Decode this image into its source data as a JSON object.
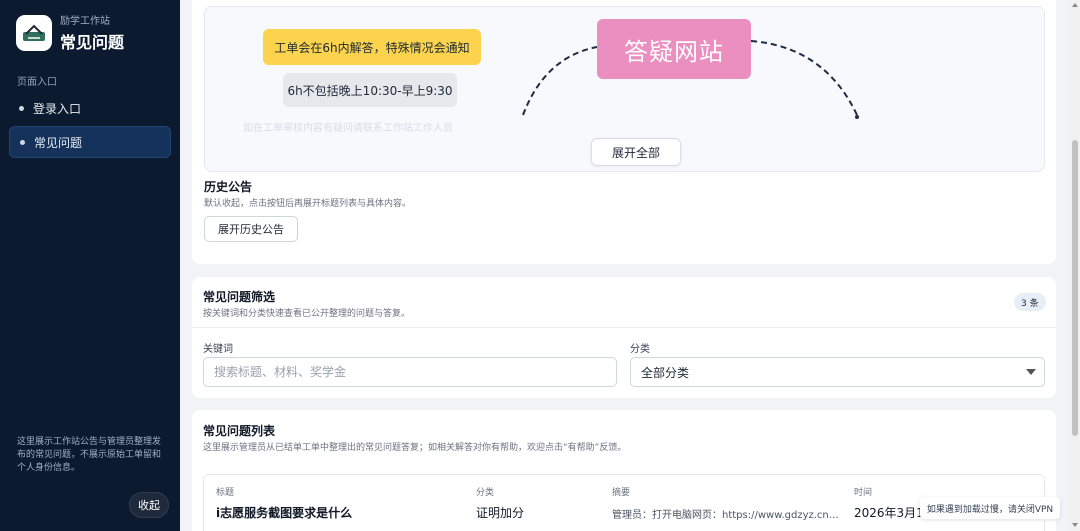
{
  "sidebar": {
    "brand_sub": "励学工作站",
    "brand_title": "常见问题",
    "section_label": "页面入口",
    "items": [
      {
        "label": "登录入口",
        "active": false
      },
      {
        "label": "常见问题",
        "active": true
      }
    ],
    "note": "这里展示工作站公告与管理员整理发布的常见问题，不展示原始工单留和个人身份信息。",
    "collapse_label": "收起"
  },
  "announcement": {
    "yellow_tag": "工单会在6h内解答，特殊情况会通知",
    "gray_tag": "6h不包括晚上10:30-早上9:30",
    "pink_box": "答疑网站",
    "faded_text": "如在工单审核内容有疑问请联系工作站工作人员",
    "expand_all": "展开全部"
  },
  "history": {
    "title": "历史公告",
    "subtitle": "默认收起，点击按钮后再展开标题列表与具体内容。",
    "button": "展开历史公告"
  },
  "filter": {
    "title": "常见问题筛选",
    "subtitle": "按关键词和分类快速查看已公开整理的问题与答复。",
    "count": "3 条",
    "keyword_label": "关键词",
    "keyword_placeholder": "搜索标题、材料、奖学金",
    "category_label": "分类",
    "category_value": "全部分类"
  },
  "faq_list": {
    "title": "常见问题列表",
    "subtitle": "这里展示管理员从已结单工单中整理出的常见问题答复；如相关解答对你有帮助，欢迎点击“有帮助”反馈。",
    "columns": [
      "标题",
      "分类",
      "摘要",
      "时间"
    ],
    "rows": [
      {
        "title": "i志愿服务截图要求是什么",
        "category": "证明加分",
        "summary": "管理员：打开电脑网页：https://www.gdzyz.cn/登...",
        "time": "2026年3月15日"
      }
    ]
  },
  "toast": "如果遇到加载过慢，请关闭VPN",
  "colors": {
    "sidebar_bg": "#0b1a2e",
    "active_item": "#14325a",
    "yellow_tag": "#fbd34d",
    "pink_box": "#ea8fbf"
  }
}
